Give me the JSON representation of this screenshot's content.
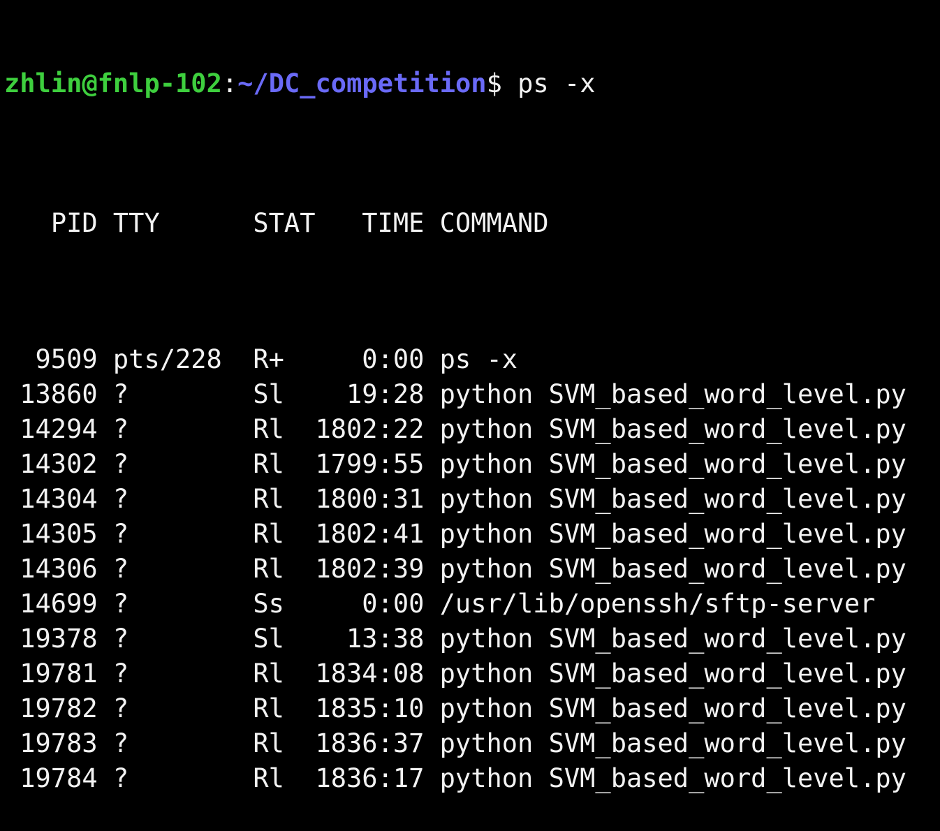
{
  "prompt": {
    "user_host": "zhlin@fnlp-102",
    "colon": ":",
    "path": "~/DC_competition",
    "symbol": "$",
    "command": " ps -x"
  },
  "headers": {
    "pid": "PID",
    "tty": "TTY",
    "stat": "STAT",
    "time": "TIME",
    "command": "COMMAND"
  },
  "rows": [
    {
      "pid": "9509",
      "tty": "pts/228",
      "stat": "R+",
      "time": "0:00",
      "command": "ps -x"
    },
    {
      "pid": "13860",
      "tty": "?",
      "stat": "Sl",
      "time": "19:28",
      "command": "python SVM_based_word_level.py"
    },
    {
      "pid": "14294",
      "tty": "?",
      "stat": "Rl",
      "time": "1802:22",
      "command": "python SVM_based_word_level.py"
    },
    {
      "pid": "14302",
      "tty": "?",
      "stat": "Rl",
      "time": "1799:55",
      "command": "python SVM_based_word_level.py"
    },
    {
      "pid": "14304",
      "tty": "?",
      "stat": "Rl",
      "time": "1800:31",
      "command": "python SVM_based_word_level.py"
    },
    {
      "pid": "14305",
      "tty": "?",
      "stat": "Rl",
      "time": "1802:41",
      "command": "python SVM_based_word_level.py"
    },
    {
      "pid": "14306",
      "tty": "?",
      "stat": "Rl",
      "time": "1802:39",
      "command": "python SVM_based_word_level.py"
    },
    {
      "pid": "14699",
      "tty": "?",
      "stat": "Ss",
      "time": "0:00",
      "command": "/usr/lib/openssh/sftp-server"
    },
    {
      "pid": "19378",
      "tty": "?",
      "stat": "Sl",
      "time": "13:38",
      "command": "python SVM_based_word_level.py"
    },
    {
      "pid": "19781",
      "tty": "?",
      "stat": "Rl",
      "time": "1834:08",
      "command": "python SVM_based_word_level.py"
    },
    {
      "pid": "19782",
      "tty": "?",
      "stat": "Rl",
      "time": "1835:10",
      "command": "python SVM_based_word_level.py"
    },
    {
      "pid": "19783",
      "tty": "?",
      "stat": "Rl",
      "time": "1836:37",
      "command": "python SVM_based_word_level.py"
    },
    {
      "pid": "19784",
      "tty": "?",
      "stat": "Rl",
      "time": "1836:17",
      "command": "python SVM_based_word_level.py"
    }
  ],
  "colors": {
    "background": "#000000",
    "text": "#f2f2f2",
    "user_host": "#3ecf3e",
    "path": "#6a6af7"
  }
}
